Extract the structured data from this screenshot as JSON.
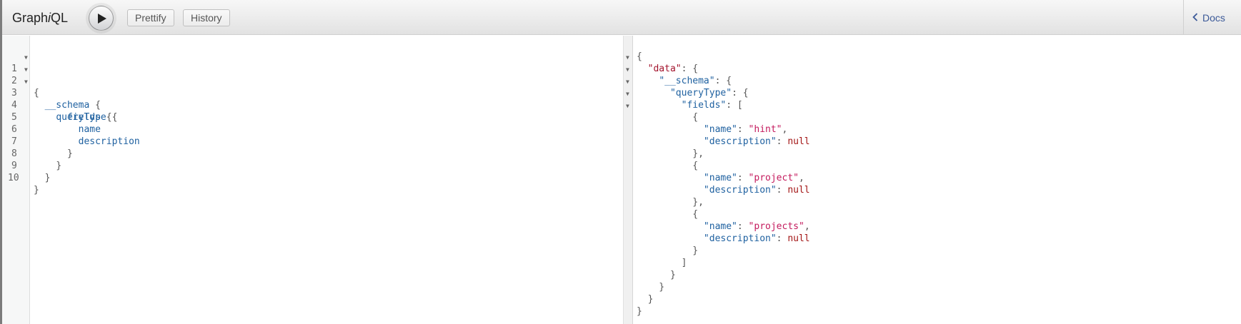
{
  "app": {
    "title_pre": "Graph",
    "title_italic": "i",
    "title_post": "QL"
  },
  "toolbar": {
    "execute_icon": "play-icon",
    "prettify_label": "Prettify",
    "history_label": "History",
    "docs_label": "Docs",
    "docs_icon": "chevron-left-icon"
  },
  "query_editor": {
    "line_numbers": [
      "1",
      "2",
      "3",
      "4",
      "5",
      "6",
      "7",
      "8",
      "9",
      "10"
    ],
    "lines": [
      {
        "indent": "",
        "text": "",
        "punct": "{"
      },
      {
        "indent": "  ",
        "text": "__schema",
        "punct": " {"
      },
      {
        "indent": "    ",
        "text": "queryType",
        "punct": " {"
      },
      {
        "indent": "      ",
        "text": "fields",
        "punct": " {"
      },
      {
        "indent": "        ",
        "text": "name",
        "punct": ""
      },
      {
        "indent": "        ",
        "text": "description",
        "punct": ""
      },
      {
        "indent": "      ",
        "text": "",
        "punct": "}"
      },
      {
        "indent": "    ",
        "text": "",
        "punct": "}"
      },
      {
        "indent": "  ",
        "text": "",
        "punct": "}"
      },
      {
        "indent": "",
        "text": "",
        "punct": "}"
      }
    ]
  },
  "result_viewer": {
    "lines": [
      "{",
      "  \"data\": {",
      "    \"__schema\": {",
      "      \"queryType\": {",
      "        \"fields\": [",
      "          {",
      "            \"name\": \"hint\",",
      "            \"description\": null",
      "          },",
      "          {",
      "            \"name\": \"project\",",
      "            \"description\": null",
      "          },",
      "          {",
      "            \"name\": \"projects\",",
      "            \"description\": null",
      "          }",
      "        ]",
      "      }",
      "    }",
      "  }",
      "}"
    ]
  },
  "colors": {
    "field": "#1f61a0",
    "data_key": "#a3132c",
    "string": "#c41a5d",
    "null": "#a31515",
    "link": "#3b5998"
  }
}
